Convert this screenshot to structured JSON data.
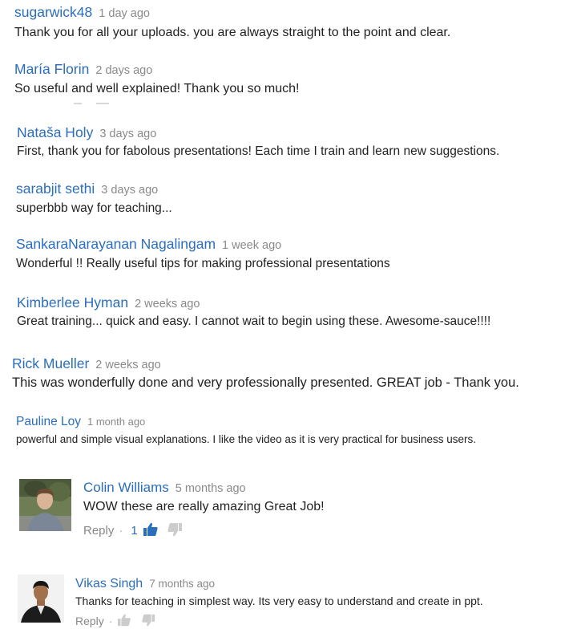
{
  "comments": [
    {
      "author": "sugarwick48",
      "time": "1 day ago",
      "text": "Thank you for all your uploads. you are always straight to the point and clear."
    },
    {
      "author": "María Florin",
      "time": "2 days ago",
      "text": "So useful and well explained! Thank you so much!"
    },
    {
      "author": "Nataša Holy",
      "time": "3 days ago",
      "text": "First, thank you for fabolous presentations! Each time I train and learn new suggestions."
    },
    {
      "author": "sarabjit sethi",
      "time": "3 days ago",
      "text": "superbbb way for teaching..."
    },
    {
      "author": "SankaraNarayanan Nagalingam",
      "time": "1 week ago",
      "text": "Wonderful !! Really useful tips for making professional presentations"
    },
    {
      "author": "Kimberlee Hyman",
      "time": "2 weeks ago",
      "text": "Great training... quick and easy. I cannot wait to begin using these. Awesome-sauce!!!!"
    },
    {
      "author": "Rick Mueller",
      "time": "2 weeks ago",
      "text": "This was wonderfully done and very professionally presented. GREAT job - Thank you."
    },
    {
      "author": "Pauline Loy",
      "time": "1 month ago",
      "text": "powerful and simple visual explanations. I like the video as it is very practical for business users."
    },
    {
      "author": "Colin Williams",
      "time": "5 months ago",
      "text": "WOW these are really amazing   Great Job!",
      "reply_label": "Reply",
      "like_count": "1"
    },
    {
      "author": "Vikas Singh",
      "time": "7 months ago",
      "text": "Thanks for teaching in simplest way. Its very easy to understand and create in ppt.",
      "reply_label": "Reply"
    }
  ],
  "colors": {
    "author": "#2a6ebd",
    "time": "#8a8a8a",
    "text": "#222222",
    "like_active": "#2a6ebd",
    "like_inactive": "#cccccc"
  },
  "icons": [
    "thumbs-up-icon",
    "thumbs-down-icon"
  ]
}
